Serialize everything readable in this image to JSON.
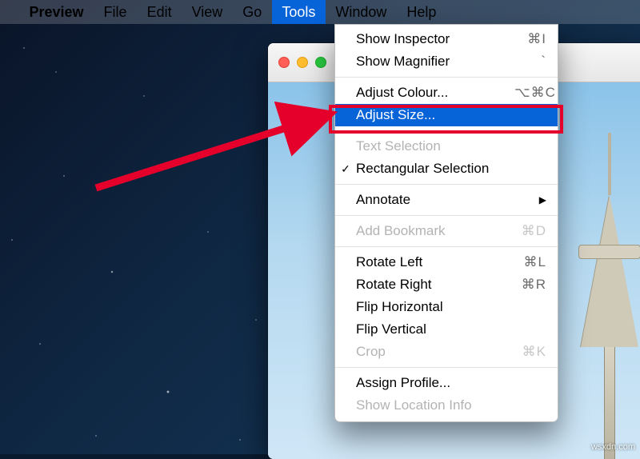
{
  "menubar": {
    "appname": "Preview",
    "items": [
      "File",
      "Edit",
      "View",
      "Go",
      "Tools",
      "Window",
      "Help"
    ],
    "active_index": 4
  },
  "tools_menu": {
    "sections": [
      [
        {
          "label": "Show Inspector",
          "shortcut": "⌘I",
          "enabled": true
        },
        {
          "label": "Show Magnifier",
          "shortcut": "`",
          "enabled": true
        }
      ],
      [
        {
          "label": "Adjust Colour...",
          "shortcut": "⌥⌘C",
          "enabled": true
        },
        {
          "label": "Adjust Size...",
          "shortcut": "",
          "enabled": true,
          "highlighted": true
        }
      ],
      [
        {
          "label": "Text Selection",
          "shortcut": "",
          "enabled": false
        },
        {
          "label": "Rectangular Selection",
          "shortcut": "",
          "enabled": true,
          "checked": true
        }
      ],
      [
        {
          "label": "Annotate",
          "shortcut": "",
          "enabled": true,
          "submenu": true
        }
      ],
      [
        {
          "label": "Add Bookmark",
          "shortcut": "⌘D",
          "enabled": false
        }
      ],
      [
        {
          "label": "Rotate Left",
          "shortcut": "⌘L",
          "enabled": true
        },
        {
          "label": "Rotate Right",
          "shortcut": "⌘R",
          "enabled": true
        },
        {
          "label": "Flip Horizontal",
          "shortcut": "",
          "enabled": true
        },
        {
          "label": "Flip Vertical",
          "shortcut": "",
          "enabled": true
        },
        {
          "label": "Crop",
          "shortcut": "⌘K",
          "enabled": false
        }
      ],
      [
        {
          "label": "Assign Profile...",
          "shortcut": "",
          "enabled": true
        },
        {
          "label": "Show Location Info",
          "shortcut": "",
          "enabled": false
        }
      ]
    ]
  },
  "watermark": "wsxdn.com"
}
